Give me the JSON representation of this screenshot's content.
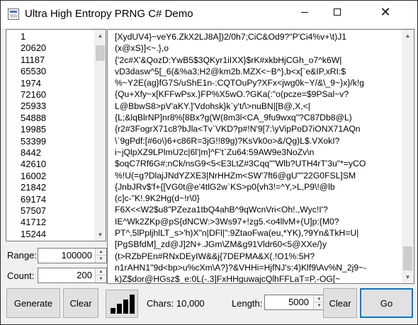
{
  "window": {
    "title": "Ultra High Entropy PRNG C# Demo"
  },
  "numbers_list": [
    "1",
    "20620",
    "11187",
    "65530",
    "1974",
    "72160",
    "25933",
    "54888",
    "19985",
    "53399",
    "8442",
    "42610",
    "16002",
    "21842",
    "69174",
    "57507",
    "41712",
    "15244"
  ],
  "output_text": [
    "[XydUV4}~veY6.ZkX2LJ8A])2/0h7;CiC&Od9?\"P'Ci4%v+\\t)J1",
    "(x@xS)]<~.},o",
    "{'2c#X'&QozD:YwB5$3QKyr1iIXX}$rK#xkbHjCGh_o7^k6W|",
    "vD3dasw^5[_6(&%a3;H2@km2b.MZX<~B^},b<x[`e&IP,xRI:$",
    "%~Y2E(ag}fG7S/uShE1n-:CQTOuPy?XFx<jwg0k~Y/&\\_9~}x}/k!g",
    "{Qu+Xfy~x[KFFwPsx.}FP%X5wO.?GKa(:\"o(pcze=$9PSal~v?",
    "L@BbwS8>pV'aKY.]'Vdohsk}k`y't/\\>nuBN|[B@,X,<|",
    "{L;&lqBlrNP]nr8%[8Bx?g(W(8m3l<CA_9fu9wxq\"?C87Db8@L)",
    "{r2#3FogrX71c8?bJla<Tv`VKD?p#!N'9[7:\\yVipPoD7iONX71AQn",
    "\\`9gPdf:[#6o\\)6+c86R=3jG!!89g)?KsVk0o>&/Qg)L$.VXokI?",
    "i~jQlpXZ9LPlmU2c|6l'|m]^F't`Zu64:59AW9e3NoZv\\n",
    "$oqC7Rf6G#;nCk/nsG9<5<E3LtZ#3Cqq\"\"Wlb?UTH4rT'3u\"*=yCO",
    "%!U(=g?DlajJNdYZXE3|NrHHZm<SW'7ft6@gU\"\"22G0FSL]SM",
    "{JnbJRv$'f+{[VG0t@e'4tlG2w`KS>p0{vh3!=^Y,>L,P9\\!@lb",
    "(c]c-\"K!.9K2Hg(d~!r\\0}",
    "F6X<<W2$u8\"PZeza1tbQ4ahB^9qWcnVri<Oh!.,Wyc!I'?",
    "IE^Wk2ZKp@pS{dNCW:>3Ws97+!zg5.<o4llvM+(U]p:{M0?",
    "PT^,5lPpljhlLT_s>'h)X\"n|DFl|\":9ZtaoFwa(eu,*YK),?9Yn&TkH=U|",
    "[PgSBfdM]_zd@J]2N+.JGm\\ZM&g91Vldr60<5@XXe/}y",
    "(t>RZbPEn#RNxDEyIW&&j{7DEPMA&X(.!O1%:5H?",
    "n1rAHN1\"9d<bp>u%cXm\\A?}?&VHHi=HjfNJ's:4)Klf9\\Av%N_2j9~-",
    "k)Z$dor@HGsz$_e:0L(-.3]FxHHguwajcQlhFFLaT=P,-OG[~"
  ],
  "controls": {
    "range_label": "Range:",
    "range_value": "100000",
    "count_label": "Count:",
    "count_value": "200",
    "generate_label": "Generate",
    "clear_left_label": "Clear",
    "chars_text": "Chars: 10,000",
    "length_label": "Length:",
    "length_value": "5000",
    "clear_right_label": "Clear",
    "go_label": "Go"
  },
  "icons": {
    "signal": "signal-bars-icon",
    "minimize": "minimize-icon",
    "maximize": "maximize-icon",
    "close": "close-icon"
  },
  "colors": {
    "accent": "#0078d7",
    "button_face": "#e1e1e1",
    "window_bg": "#f0f0f0"
  }
}
